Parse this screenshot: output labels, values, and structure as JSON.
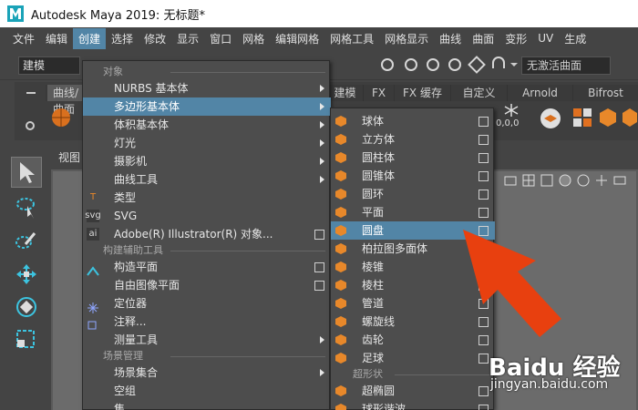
{
  "window": {
    "title": "Autodesk Maya 2019: 无标题*"
  },
  "menubar": [
    "文件",
    "编辑",
    "创建",
    "选择",
    "修改",
    "显示",
    "窗口",
    "网格",
    "编辑网格",
    "网格工具",
    "网格显示",
    "曲线",
    "曲面",
    "变形",
    "UV",
    "生成"
  ],
  "status_line": {
    "mode": "建模",
    "live_surface": "无激活曲面"
  },
  "shelf": {
    "tabs": [
      "曲线/曲面",
      "建模",
      "FX",
      "FX 缓存",
      "自定义",
      "Arnold",
      "Bifrost"
    ],
    "coords_label": "0,0,0"
  },
  "viewport": {
    "label": "视图"
  },
  "create_menu": {
    "section_objects": "对象",
    "items_a": [
      {
        "label": "NURBS 基本体",
        "submenu": true
      },
      {
        "label": "多边形基本体",
        "submenu": true,
        "highlighted": true
      },
      {
        "label": "体积基本体",
        "submenu": true
      },
      {
        "label": "灯光",
        "submenu": true
      },
      {
        "label": "摄影机",
        "submenu": true
      },
      {
        "label": "曲线工具",
        "submenu": true
      },
      {
        "label": "类型",
        "icon": "T"
      },
      {
        "label": "SVG",
        "icon": "svg"
      },
      {
        "label": "Adobe(R) Illustrator(R) 对象...",
        "icon": "ai",
        "option_box": true
      }
    ],
    "section_construction": "构建辅助工具",
    "items_b": [
      {
        "label": "构造平面",
        "option_box": true
      },
      {
        "label": "自由图像平面",
        "option_box": true
      },
      {
        "label": "定位器"
      },
      {
        "label": "注释..."
      },
      {
        "label": "测量工具",
        "submenu": true
      }
    ],
    "section_scene": "场景管理",
    "items_c": [
      {
        "label": "场景集合",
        "submenu": true
      },
      {
        "label": "空组"
      },
      {
        "label": "集"
      }
    ]
  },
  "poly_submenu": {
    "items": [
      {
        "label": "球体"
      },
      {
        "label": "立方体"
      },
      {
        "label": "圆柱体"
      },
      {
        "label": "圆锥体"
      },
      {
        "label": "圆环"
      },
      {
        "label": "平面"
      },
      {
        "label": "圆盘",
        "highlighted": true
      },
      {
        "label": "柏拉图多面体"
      },
      {
        "label": "棱锥"
      },
      {
        "label": "棱柱"
      },
      {
        "label": "管道"
      },
      {
        "label": "螺旋线"
      },
      {
        "label": "齿轮"
      },
      {
        "label": "足球"
      }
    ],
    "section_super": "超形状",
    "items_super": [
      {
        "label": "超椭圆"
      },
      {
        "label": "球形谐波"
      }
    ]
  },
  "colors": {
    "accent": "#5285a6",
    "arrow": "#e8400f",
    "menu_bg": "#4d4d4d"
  },
  "watermark": {
    "logo": "Baidu 经验",
    "url": "jingyan.baidu.com"
  }
}
